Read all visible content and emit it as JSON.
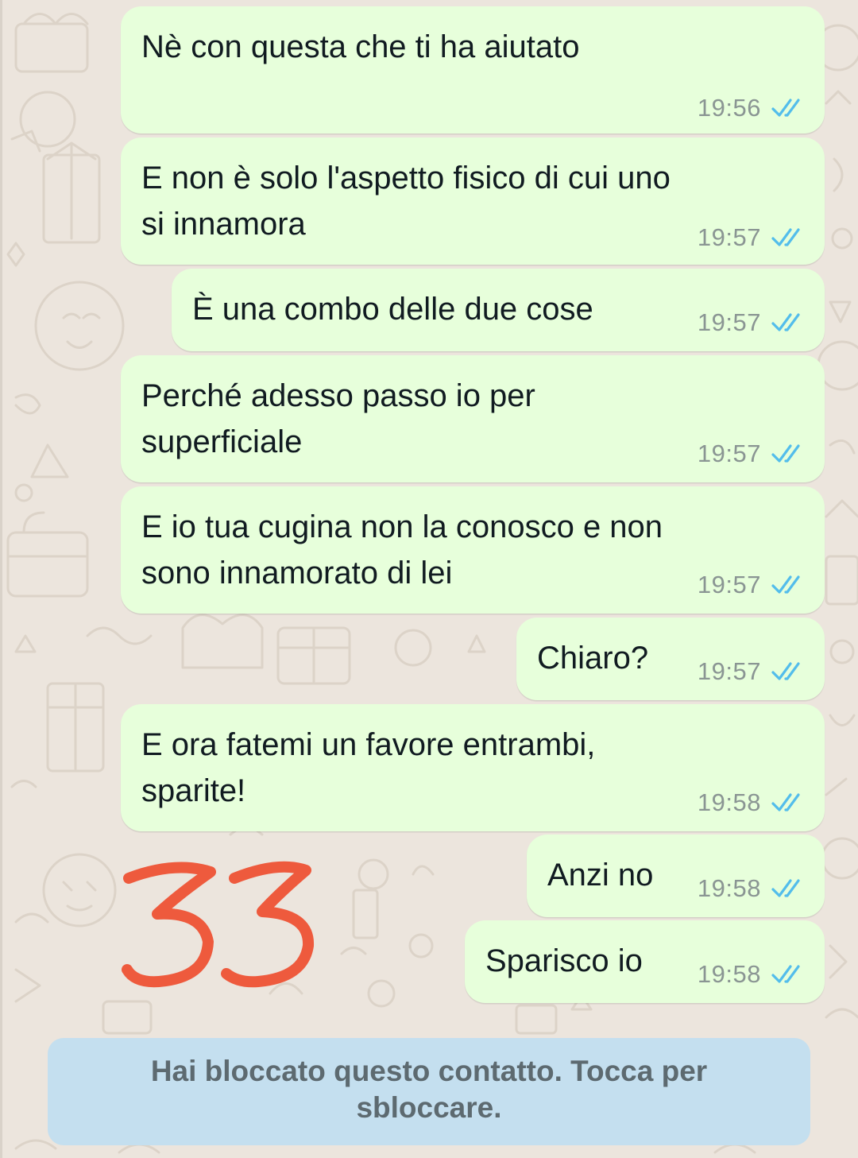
{
  "chat": {
    "messages": [
      {
        "text": [
          "Nè con questa che ti ha aiutato"
        ],
        "time": "19:56"
      },
      {
        "text": [
          "E non è solo l'aspetto fisico di cui uno",
          "si innamora"
        ],
        "time": "19:57"
      },
      {
        "text": [
          "È una combo delle due cose"
        ],
        "time": "19:57"
      },
      {
        "text": [
          "Perché adesso passo io per",
          "superficiale"
        ],
        "time": "19:57"
      },
      {
        "text": [
          "E io tua cugina non la conosco e non",
          "sono innamorato di lei"
        ],
        "time": "19:57"
      },
      {
        "text": [
          "Chiaro?"
        ],
        "time": "19:57"
      },
      {
        "text": [
          "E ora fatemi un favore entrambi,",
          "sparite!"
        ],
        "time": "19:58"
      },
      {
        "text": [
          "Anzi no"
        ],
        "time": "19:58"
      },
      {
        "text": [
          "Sparisco io"
        ],
        "time": "19:58"
      }
    ]
  },
  "blocked_banner": {
    "line1": "Hai bloccato questo contatto. Tocca per",
    "line2": "sbloccare."
  },
  "annotation": {
    "number": "33",
    "color": "#EE5A3D"
  },
  "colors": {
    "outgoing_bubble": "#E7FFDB",
    "read_tick": "#53BDEB",
    "wallpaper": "#ECE5DD",
    "banner": "#C4DFEF"
  },
  "icons": {
    "read_receipt": "double-check-icon"
  }
}
